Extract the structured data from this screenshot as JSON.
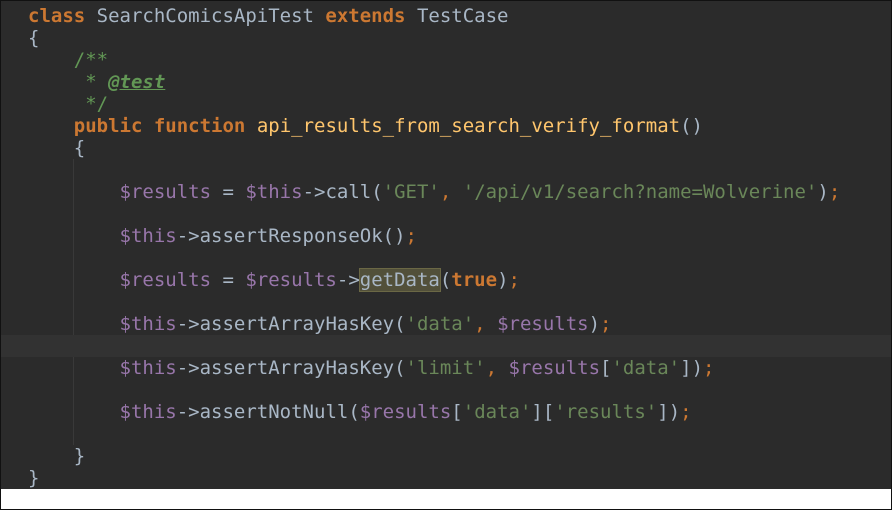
{
  "code": {
    "line1": {
      "kw_class": "class",
      "class_name": " SearchComicsApiTest ",
      "kw_extends": "extends",
      "parent": " TestCase"
    },
    "line2": "{",
    "line3": "/**",
    "line4_star": "* ",
    "line4_tag": "@test",
    "line5": "*/",
    "line6": {
      "kw_public": "public",
      "kw_function": "function",
      "fn_name": "api_results_from_search_verify_format",
      "parens": "()"
    },
    "line7": "{",
    "line9": {
      "var_results": "$results",
      "op": " = ",
      "var_this": "$this",
      "arrow": "->",
      "method": "call",
      "open": "(",
      "arg1": "'GET'",
      "comma": ", ",
      "arg2": "'/api/v1/search?name=Wolverine'",
      "close": ")",
      "semi": ";"
    },
    "line11": {
      "var_this": "$this",
      "arrow": "->",
      "method": "assertResponseOk",
      "parens": "()",
      "semi": ";"
    },
    "line13": {
      "var_results": "$results",
      "op": " = ",
      "var_results2": "$results",
      "arrow": "->",
      "method": "getData",
      "open": "(",
      "arg": "true",
      "close": ")",
      "semi": ";"
    },
    "line15": {
      "var_this": "$this",
      "arrow": "->",
      "method": "assertArrayHasKey",
      "open": "(",
      "arg1": "'data'",
      "comma": ", ",
      "arg2": "$results",
      "close": ")",
      "semi": ";"
    },
    "line17": {
      "var_this": "$this",
      "arrow": "->",
      "method": "assertArrayHasKey",
      "open": "(",
      "arg1": "'limit'",
      "comma": ", ",
      "arg2": "$results",
      "br_open": "[",
      "arg3": "'data'",
      "br_close": "]",
      "close": ")",
      "semi": ";"
    },
    "line19": {
      "var_this": "$this",
      "arrow": "->",
      "method": "assertNotNull",
      "open": "(",
      "arg1": "$results",
      "br1_open": "[",
      "key1": "'data'",
      "br1_close": "]",
      "br2_open": "[",
      "key2": "'results'",
      "br2_close": "]",
      "close": ")",
      "semi": ";"
    },
    "line21": "}",
    "line22": "}"
  },
  "colors": {
    "background": "#2b2b2b",
    "keyword": "#cc7832",
    "function": "#ffc66d",
    "variable": "#9876aa",
    "string": "#6a8759",
    "comment": "#629755",
    "text": "#a9b7c6"
  }
}
